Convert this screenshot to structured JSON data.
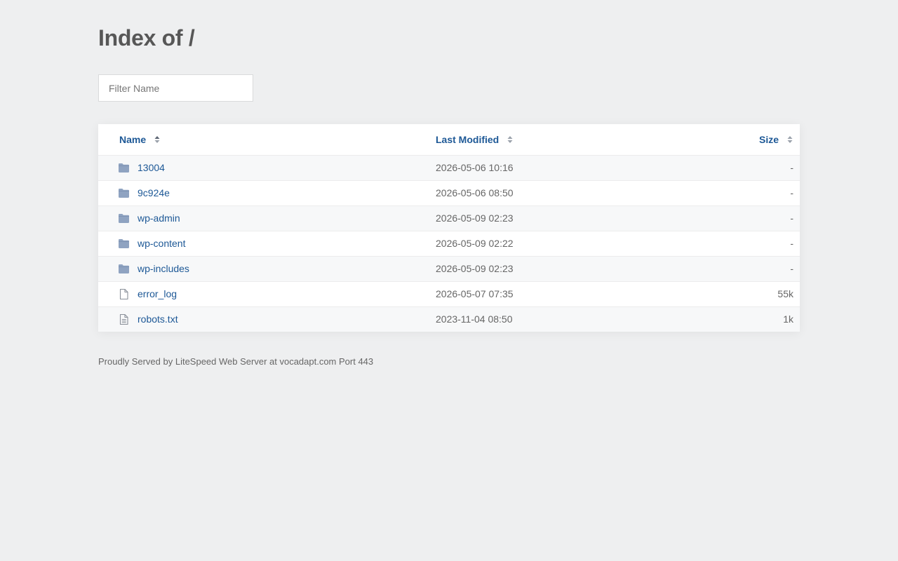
{
  "page": {
    "title": "Index of /",
    "filter_placeholder": "Filter Name",
    "footer": "Proudly Served by LiteSpeed Web Server at vocadapt.com Port 443"
  },
  "table": {
    "headers": {
      "name": "Name",
      "last_modified": "Last Modified",
      "size": "Size"
    },
    "rows": [
      {
        "name": "13004",
        "modified": "2026-05-06 10:16",
        "size": "-",
        "icon": "folder-icon"
      },
      {
        "name": "9c924e",
        "modified": "2026-05-06 08:50",
        "size": "-",
        "icon": "folder-icon"
      },
      {
        "name": "wp-admin",
        "modified": "2026-05-09 02:23",
        "size": "-",
        "icon": "folder-icon"
      },
      {
        "name": "wp-content",
        "modified": "2026-05-09 02:22",
        "size": "-",
        "icon": "folder-icon"
      },
      {
        "name": "wp-includes",
        "modified": "2026-05-09 02:23",
        "size": "-",
        "icon": "folder-icon"
      },
      {
        "name": "error_log",
        "modified": "2026-05-07 07:35",
        "size": "55k",
        "icon": "file-icon"
      },
      {
        "name": "robots.txt",
        "modified": "2023-11-04 08:50",
        "size": "1k",
        "icon": "text-file-icon"
      }
    ]
  },
  "colors": {
    "background": "#eeeff0",
    "link": "#1d5896",
    "folder_icon": "#8fa3c1",
    "file_icon": "#8a9099"
  }
}
